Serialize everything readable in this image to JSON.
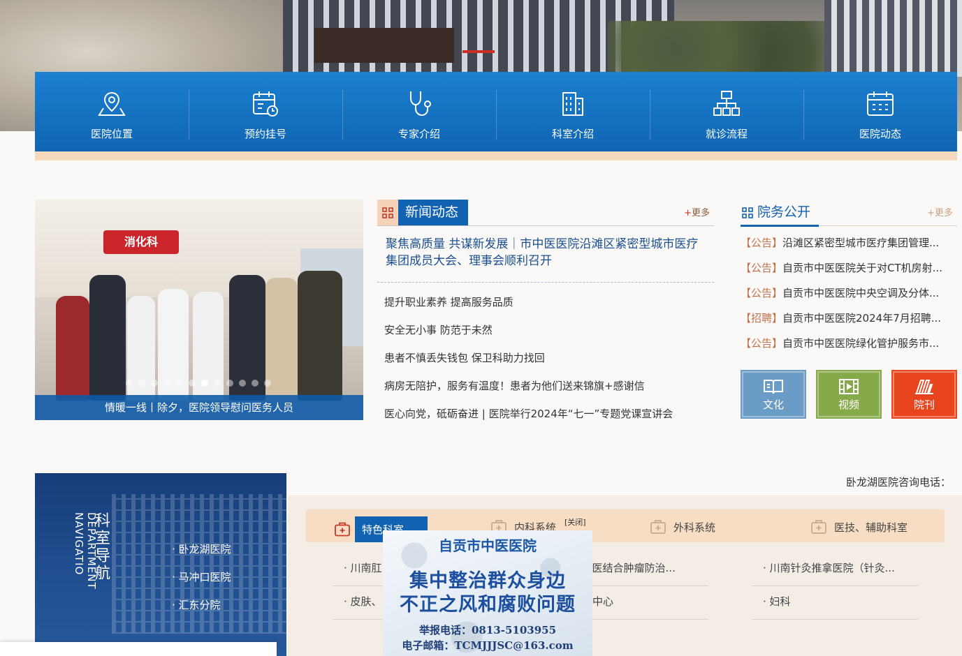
{
  "quicknav": {
    "items": [
      {
        "label": "医院位置",
        "icon": "location-icon"
      },
      {
        "label": "预约挂号",
        "icon": "calendar-clock-icon"
      },
      {
        "label": "专家介绍",
        "icon": "stethoscope-icon"
      },
      {
        "label": "科室介绍",
        "icon": "building-icon"
      },
      {
        "label": "就诊流程",
        "icon": "flowchart-icon"
      },
      {
        "label": "医院动态",
        "icon": "calendar-icon"
      }
    ]
  },
  "slider": {
    "sign_text": "消化科",
    "caption": "情暖一线丨除夕，医院领导慰问医务人员",
    "dot_count": 12,
    "active_dot": 7
  },
  "news": {
    "title": "新闻动态",
    "more_plus": "+",
    "more_label": "更多",
    "headline": "聚焦高质量 共谋新发展｜市中医医院沿滩区紧密型城市医疗集团成员大会、理事会顺利召开",
    "items": [
      "提升职业素养 提高服务品质",
      "安全无小事 防范于未然",
      "患者不慎丢失钱包 保卫科助力找回",
      "病房无陪护，服务有温度！患者为他们送来锦旗+感谢信",
      "医心向党，砥砺奋进 | 医院举行2024年“七一”专题党课宣讲会"
    ]
  },
  "notices": {
    "title": "院务公开",
    "more_label": "+更多",
    "items": [
      {
        "tag": "【公告】",
        "text": "沿滩区紧密型城市医疗集团管理..."
      },
      {
        "tag": "【公告】",
        "text": "自贡市中医医院关于对CT机房射..."
      },
      {
        "tag": "【公告】",
        "text": "自贡市中医医院中央空调及分体..."
      },
      {
        "tag": "【招聘】",
        "text": "自贡市中医医院2024年7月招聘..."
      },
      {
        "tag": "【公告】",
        "text": "自贡市中医医院绿化管护服务市..."
      }
    ]
  },
  "tiles": [
    {
      "label": "文化",
      "icon": "book-icon",
      "color": "#6a9cc6"
    },
    {
      "label": "视频",
      "icon": "film-icon",
      "color": "#86a94a"
    },
    {
      "label": "院刊",
      "icon": "magazine-icon",
      "color": "#e8451e"
    }
  ],
  "deptnav": {
    "title": "科室导航",
    "title_en": "DEPARTMENT NAVIGATIO",
    "branches": [
      "· 卧龙湖医院",
      "· 马冲口医院",
      "· 汇东分院"
    ]
  },
  "phone_label": "卧龙湖医院咨询电话：",
  "dept_tabs": [
    {
      "label": "特色科室",
      "icon": "medkit-icon"
    },
    {
      "label": "内科系统",
      "icon": "medkit-icon"
    },
    {
      "label": "外科系统",
      "icon": "medkit-icon"
    },
    {
      "label": "医技、辅助科室",
      "icon": "medkit-icon"
    }
  ],
  "dept_items": [
    "· 川南肛",
    "· 中西医结合肿瘤防治...",
    "· 川南针灸推拿医院（针灸...",
    "· 皮肤、",
    "中心",
    "· 妇科"
  ],
  "popup": {
    "close_label": "[关闭]",
    "hospital": "自贡市中医医院",
    "line1": "集中整治群众身边",
    "line2": "不正之风和腐败问题",
    "tel": "举报电话：0813-5103955",
    "email": "电子邮箱：TCMJJJSC@163.com"
  },
  "colors": {
    "primary_blue": "#1262b2",
    "accent_peach": "#f5d9bd",
    "notice_tag": "#c0734a"
  }
}
